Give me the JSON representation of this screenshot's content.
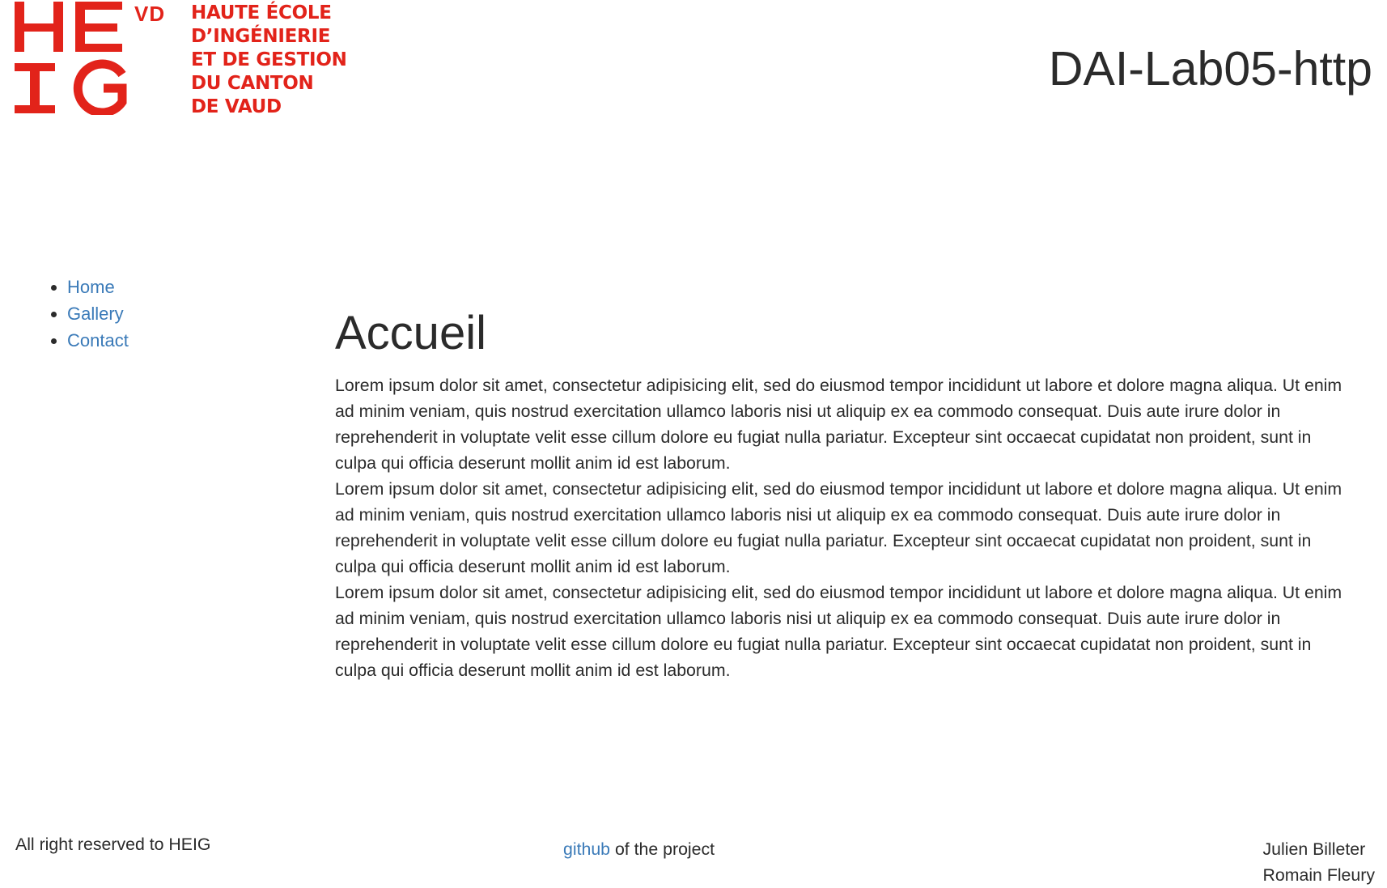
{
  "header": {
    "logo": {
      "mark": "HEIG",
      "region": "VD",
      "lines": [
        "HAUTE ÉCOLE",
        "D’INGÉNIERIE",
        "ET DE GESTION",
        "DU CANTON",
        "DE VAUD"
      ],
      "color": "#e2231a"
    },
    "site_title": "DAI-Lab05-http"
  },
  "nav": {
    "items": [
      {
        "label": "Home"
      },
      {
        "label": "Gallery"
      },
      {
        "label": "Contact"
      }
    ],
    "link_color": "#3a7ab8"
  },
  "main": {
    "title": "Accueil",
    "paragraphs": [
      "Lorem ipsum dolor sit amet, consectetur adipisicing elit, sed do eiusmod tempor incididunt ut labore et dolore magna aliqua. Ut enim ad minim veniam, quis nostrud exercitation ullamco laboris nisi ut aliquip ex ea commodo consequat. Duis aute irure dolor in reprehenderit in voluptate velit esse cillum dolore eu fugiat nulla pariatur. Excepteur sint occaecat cupidatat non proident, sunt in culpa qui officia deserunt mollit anim id est laborum.",
      "Lorem ipsum dolor sit amet, consectetur adipisicing elit, sed do eiusmod tempor incididunt ut labore et dolore magna aliqua. Ut enim ad minim veniam, quis nostrud exercitation ullamco laboris nisi ut aliquip ex ea commodo consequat. Duis aute irure dolor in reprehenderit in voluptate velit esse cillum dolore eu fugiat nulla pariatur. Excepteur sint occaecat cupidatat non proident, sunt in culpa qui officia deserunt mollit anim id est laborum.",
      "Lorem ipsum dolor sit amet, consectetur adipisicing elit, sed do eiusmod tempor incididunt ut labore et dolore magna aliqua. Ut enim ad minim veniam, quis nostrud exercitation ullamco laboris nisi ut aliquip ex ea commodo consequat. Duis aute irure dolor in reprehenderit in voluptate velit esse cillum dolore eu fugiat nulla pariatur. Excepteur sint occaecat cupidatat non proident, sunt in culpa qui officia deserunt mollit anim id est laborum."
    ]
  },
  "footer": {
    "rights": "All right reserved to HEIG",
    "github_link": "github",
    "github_suffix": " of the project",
    "authors": [
      "Julien Billeter",
      "Romain Fleury"
    ]
  }
}
